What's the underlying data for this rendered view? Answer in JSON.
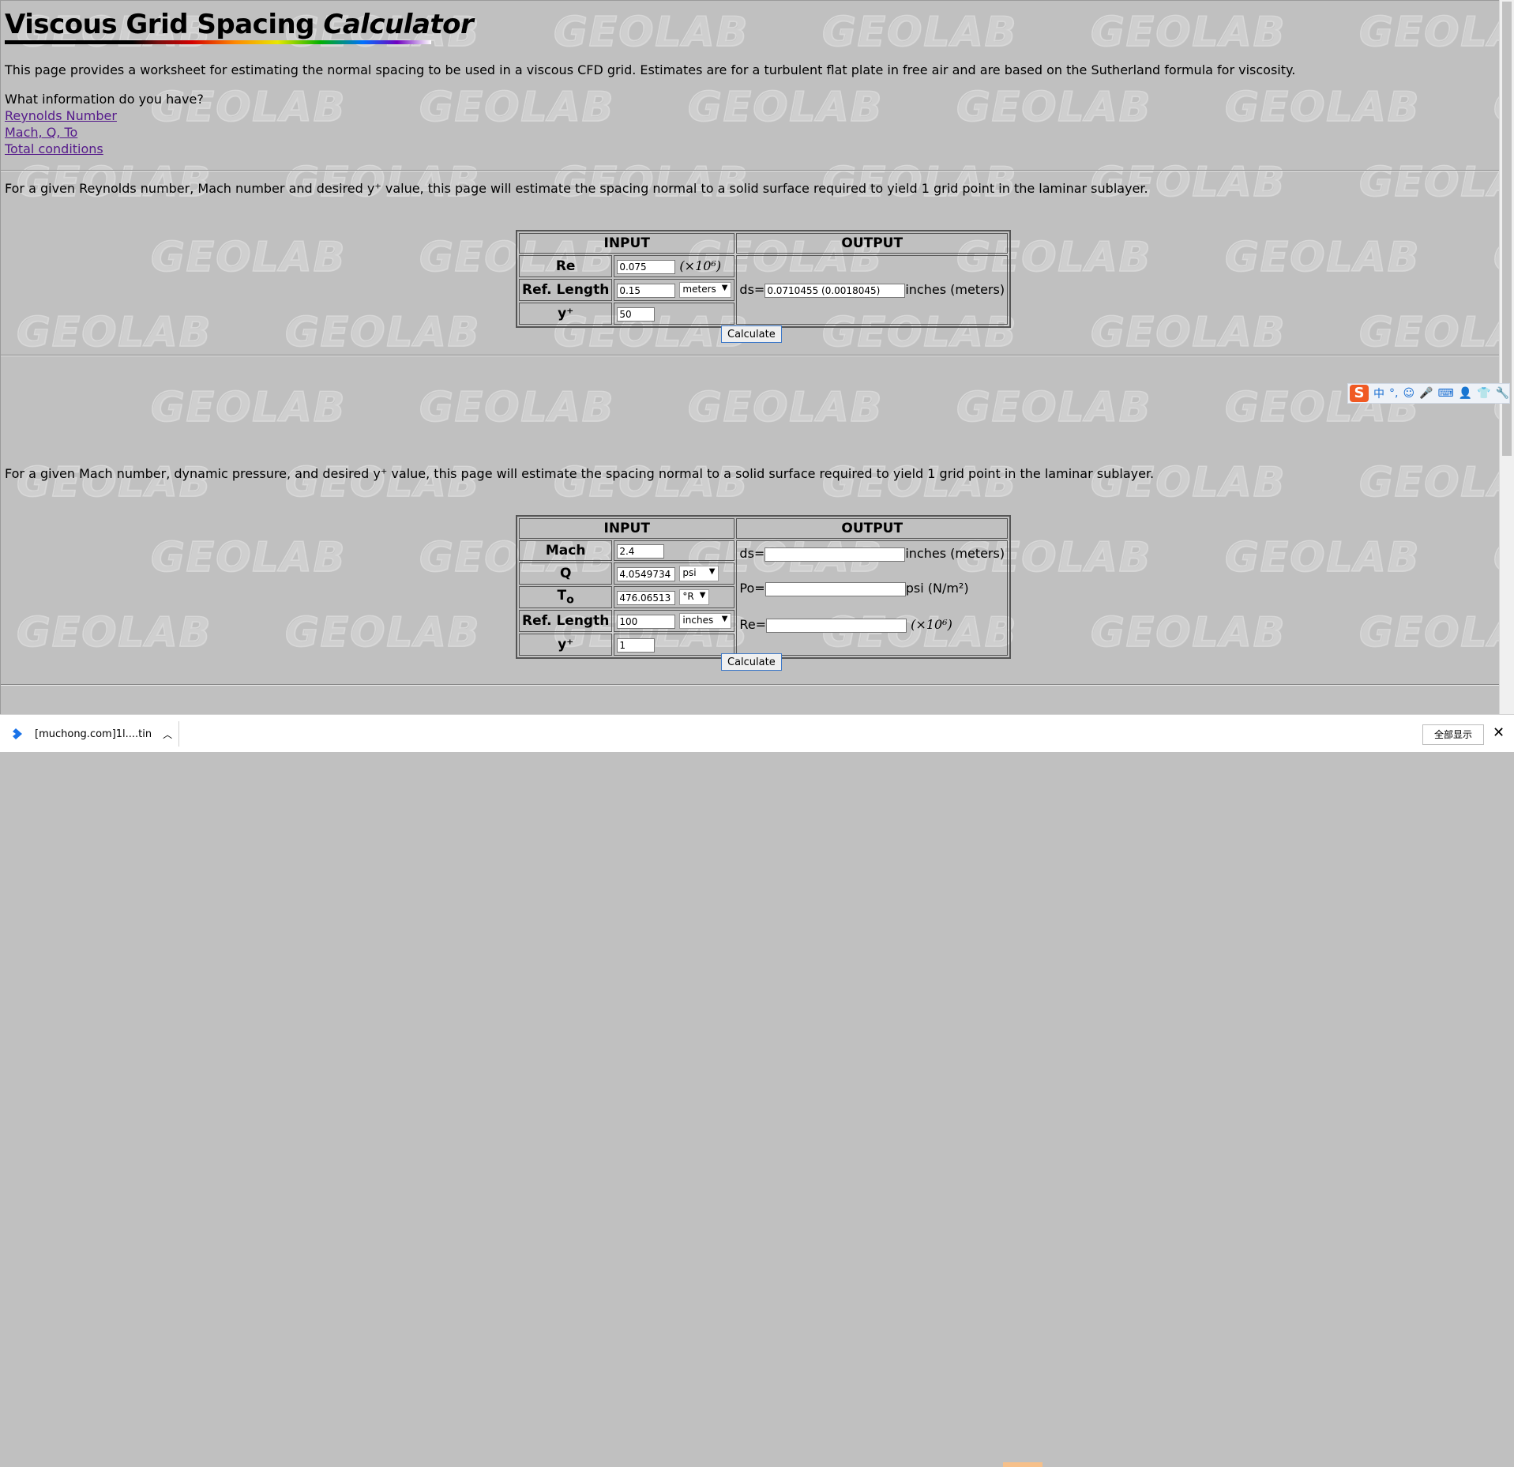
{
  "page": {
    "title_main": "Viscous Grid Spacing ",
    "title_italic": "Calculator",
    "intro": "This page provides a worksheet for estimating the normal spacing to be used in a viscous CFD grid. Estimates are for a turbulent flat plate in free air and are based on the Sutherland formula for viscosity.",
    "question": "What information do you have?",
    "links": [
      "Reynolds Number",
      "Mach, Q, To",
      "Total conditions"
    ],
    "watermark": "GEOLAB"
  },
  "section1": {
    "desc": "For a given Reynolds number, Mach number and desired y⁺ value, this page will estimate the spacing normal to a solid surface required to yield 1 grid point in the laminar sublayer.",
    "input_header": "INPUT",
    "output_header": "OUTPUT",
    "re_label": "Re",
    "re_value": "0.075",
    "re_unit": "(×10⁶)",
    "reflen_label": "Ref. Length",
    "reflen_value": "0.15",
    "reflen_unit": "meters",
    "yplus_label": "y⁺",
    "yplus_value": "50",
    "ds_label": "ds=",
    "ds_value": "0.0710455 (0.0018045)",
    "ds_unit": "inches (meters)",
    "calculate": "Calculate"
  },
  "section2": {
    "desc": "For a given Mach number, dynamic pressure, and desired y⁺ value, this page will estimate the spacing normal to a solid surface required to yield 1 grid point in the laminar sublayer.",
    "input_header": "INPUT",
    "output_header": "OUTPUT",
    "mach_label": "Mach",
    "mach_value": "2.4",
    "q_label": "Q",
    "q_value": "4.0549734",
    "q_unit": "psi",
    "to_label": "T",
    "to_sub": "o",
    "to_value": "476.06513",
    "to_unit": "°R",
    "reflen_label": "Ref. Length",
    "reflen_value": "100",
    "reflen_unit": "inches",
    "yplus_label": "y⁺",
    "yplus_value": "1",
    "ds_label": "ds=",
    "ds_value": "",
    "ds_unit": "inches (meters)",
    "po_label": "Po=",
    "po_value": "",
    "po_unit": "psi (N/m²)",
    "re_label": "Re=",
    "re_value": "",
    "re_unit": "(×10⁶)",
    "calculate": "Calculate"
  },
  "download_bar": {
    "filename": "[muchong.com]1l....tin",
    "show_all": "全部显示",
    "close": "✕"
  },
  "ime": {
    "logo": "S",
    "items": [
      "中",
      "°,",
      "☺",
      "🎤",
      "⌨",
      "👤",
      "👕",
      "🔧"
    ]
  }
}
